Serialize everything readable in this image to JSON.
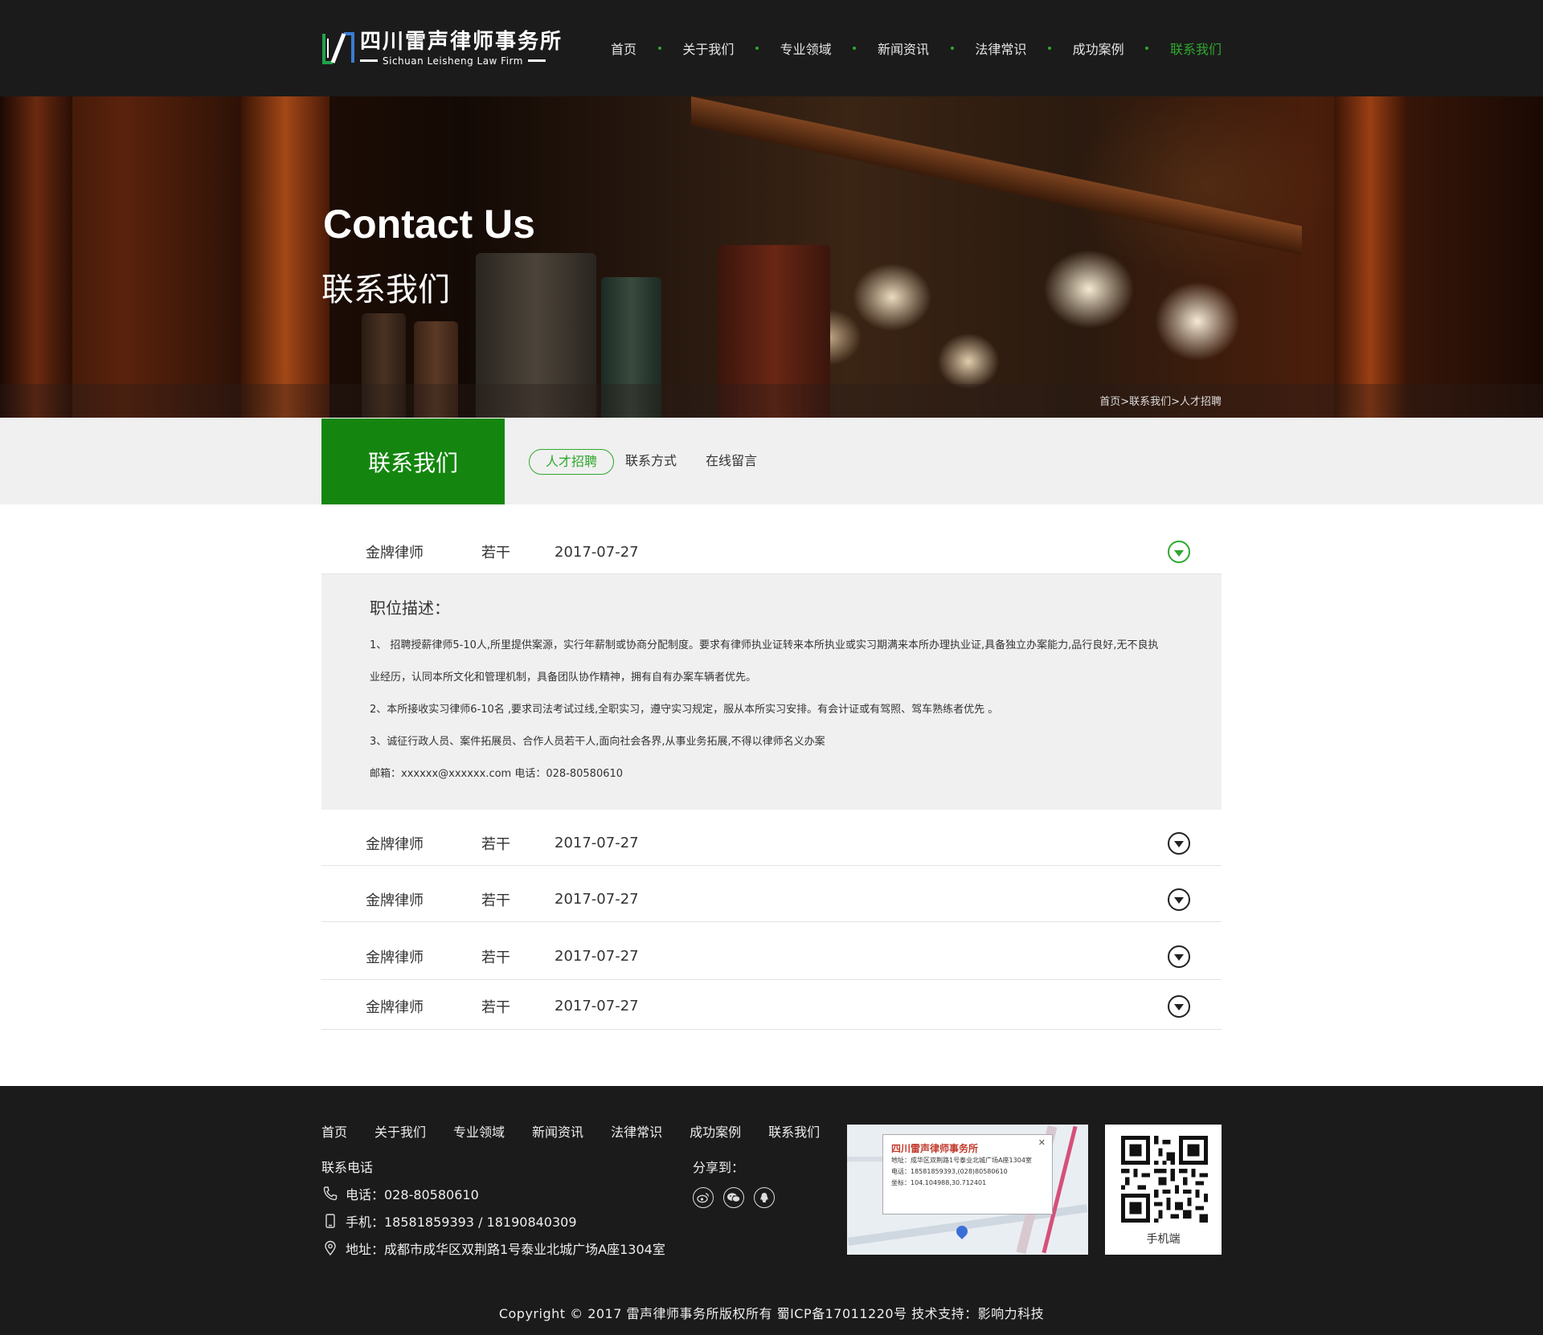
{
  "brand": {
    "name_cn": "四川雷声律师事务所",
    "name_en": "Sichuan Leisheng Law Firm"
  },
  "nav": {
    "items": [
      "首页",
      "关于我们",
      "专业领域",
      "新闻资讯",
      "法律常识",
      "成功案例",
      "联系我们"
    ],
    "active": "联系我们"
  },
  "banner": {
    "title_en": "Contact Us",
    "title_cn": "联系我们",
    "breadcrumb": "首页>联系我们>人才招聘"
  },
  "subnav": {
    "title": "联系我们",
    "tabs": [
      "人才招聘",
      "联系方式",
      "在线留言"
    ],
    "active_tab": "人才招聘"
  },
  "jobs": [
    {
      "title": "金牌律师",
      "count": "若干",
      "date": "2017-07-27",
      "expanded": true
    },
    {
      "title": "金牌律师",
      "count": "若干",
      "date": "2017-07-27",
      "expanded": false
    },
    {
      "title": "金牌律师",
      "count": "若干",
      "date": "2017-07-27",
      "expanded": false
    },
    {
      "title": "金牌律师",
      "count": "若干",
      "date": "2017-07-27",
      "expanded": false
    },
    {
      "title": "金牌律师",
      "count": "若干",
      "date": "2017-07-27",
      "expanded": false
    }
  ],
  "job_detail": {
    "heading": "职位描述：",
    "lines": [
      "1、 招聘授薪律师5-10人,所里提供案源，实行年薪制或协商分配制度。要求有律师执业证转来本所执业或实习期满来本所办理执业证,具备独立办案能力,品行良好,无不良执",
      "业经历，认同本所文化和管理机制，具备团队协作精神，拥有自有办案车辆者优先。",
      "2、本所接收实习律师6-10名 ,要求司法考试过线,全职实习，遵守实习规定，服从本所实习安排。有会计证或有驾照、驾车熟练者优先 。",
      "3、诚征行政人员、案件拓展员、合作人员若干人,面向社会各界,从事业务拓展,不得以律师名义办案",
      "邮箱：xxxxxx@xxxxxx.com 电话：028-80580610"
    ]
  },
  "footer": {
    "nav": [
      "首页",
      "关于我们",
      "专业领域",
      "新闻资讯",
      "法律常识",
      "成功案例",
      "联系我们"
    ],
    "contact_heading": "联系电话",
    "phone": "电话：028-80580610",
    "mobile": "手机：18581859393 / 18190840309",
    "address": "地址：成都市成华区双荆路1号泰业北城广场A座1304室",
    "share_heading": "分享到：",
    "share_icons": [
      "weibo-icon",
      "wechat-icon",
      "qq-icon"
    ],
    "map_popup": {
      "title": "四川雷声律师事务所",
      "address": "地址：成华区双荆路1号泰业北城广场A座1304室",
      "phone": "电话：18581859393,(028)80580610",
      "coords": "坐标：104.104988,30.712401"
    },
    "qr_label": "手机端",
    "copyright": "Copyright © 2017 雷声律师事务所版权所有 蜀ICP备17011220号   技术支持：影响力科技"
  },
  "colors": {
    "accent": "#14860f",
    "accent_light": "#2ea82e",
    "header_bg": "#1b1b1b",
    "footer_bg": "#1b1b1b"
  }
}
